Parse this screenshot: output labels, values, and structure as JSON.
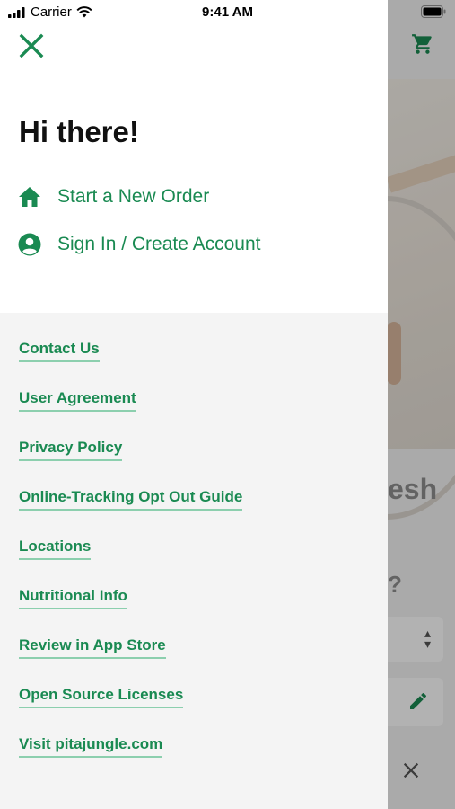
{
  "status_bar": {
    "carrier": "Carrier",
    "time": "9:41 AM"
  },
  "drawer": {
    "greeting": "Hi there!",
    "actions": [
      {
        "label": "Start a New Order",
        "icon": "home-icon"
      },
      {
        "label": "Sign In / Create Account",
        "icon": "account-circle-icon"
      }
    ],
    "links": [
      "Contact Us",
      "User Agreement",
      "Privacy Policy",
      "Online-Tracking Opt Out Guide",
      "Locations",
      "Nutritional Info",
      "Review in App Store",
      "Open Source Licenses",
      "Visit pitajungle.com"
    ]
  },
  "background": {
    "headline_fragment": "esh",
    "question_fragment": "?"
  },
  "colors": {
    "accent_green": "#1a8a52",
    "link_underline": "#8ccfae",
    "drawer_bg": "#f4f4f4"
  }
}
